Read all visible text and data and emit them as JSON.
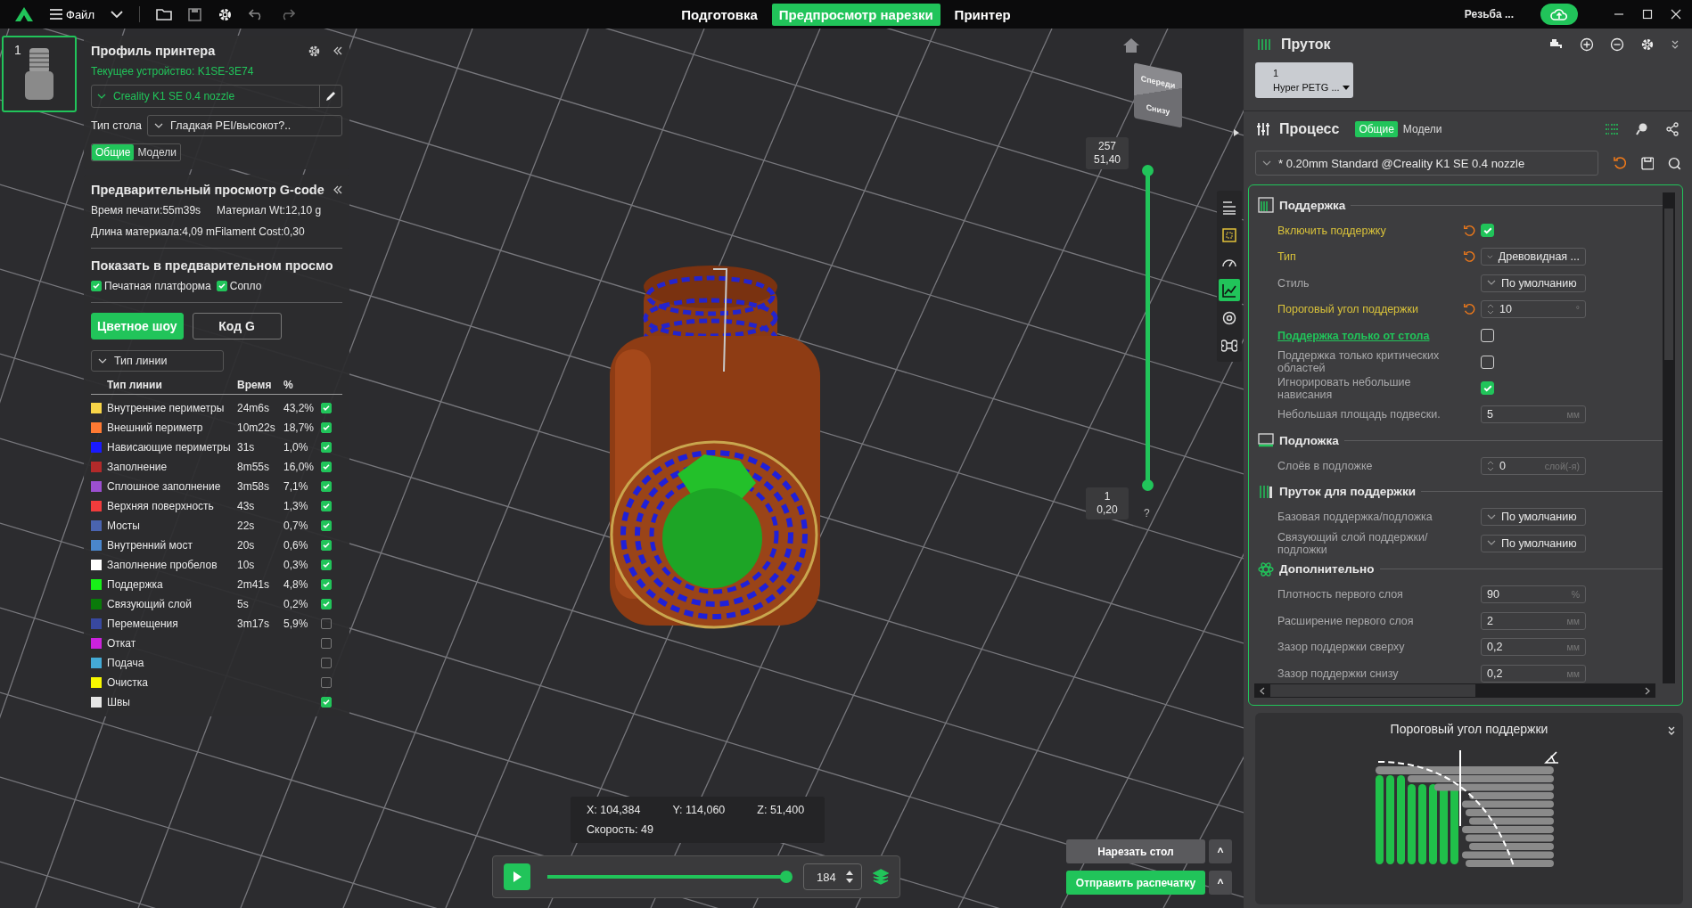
{
  "menu_bar": {
    "file_label": "Файл",
    "tabs": [
      {
        "label": "Подготовка",
        "selected": false
      },
      {
        "label": "Предпросмотр нарезки",
        "selected": true
      },
      {
        "label": "Принтер",
        "selected": false
      }
    ],
    "project_name": "Резьба ..."
  },
  "plates": [
    {
      "number": "1",
      "selected": true
    }
  ],
  "printer_profile": {
    "title": "Профиль принтера",
    "current_device": "Текущее устройство: K1SE-3E74",
    "printer": "Creality K1 SE 0.4 nozzle",
    "bed_label": "Тип стола",
    "bed_type": "Гладкая PEI/высокот?..",
    "tabs": [
      {
        "label": "Общие",
        "selected": true
      },
      {
        "label": "Модели",
        "selected": false
      }
    ]
  },
  "gcode_preview": {
    "title": "Предварительный просмотр G-code",
    "stats": [
      "Время печати:55m39s",
      "Материал Wt:12,10 g",
      "Длина материала:4,09 mFilament Cost:0,30"
    ],
    "show_title": "Показать в предварительном просмо",
    "show_options": [
      {
        "label": "Печатная платформа",
        "checked": true
      },
      {
        "label": "Сопло",
        "checked": true
      }
    ],
    "view_tabs": [
      {
        "label": "Цветное шоу",
        "selected": true
      },
      {
        "label": "Код G",
        "selected": false
      }
    ],
    "view_type": "Тип линии",
    "columns": [
      "Тип линии",
      "Время",
      "%"
    ],
    "rows": [
      {
        "color": "#f8d548",
        "name": "Внутренние периметры",
        "time": "24m6s",
        "percent": "43,2%",
        "checked": true
      },
      {
        "color": "#ff7a33",
        "name": "Внешний периметр",
        "time": "10m22s",
        "percent": "18,7%",
        "checked": true
      },
      {
        "color": "#1a1aff",
        "name": "Нависающие периметры",
        "time": "31s",
        "percent": "1,0%",
        "checked": true
      },
      {
        "color": "#b22a2a",
        "name": "Заполнение",
        "time": "8m55s",
        "percent": "16,0%",
        "checked": true
      },
      {
        "color": "#9b4fd0",
        "name": "Сплошное заполнение",
        "time": "3m58s",
        "percent": "7,1%",
        "checked": true
      },
      {
        "color": "#f03c3c",
        "name": "Верхняя поверхность",
        "time": "43s",
        "percent": "1,3%",
        "checked": true
      },
      {
        "color": "#4a64b0",
        "name": "Мосты",
        "time": "22s",
        "percent": "0,7%",
        "checked": true
      },
      {
        "color": "#4a86cc",
        "name": "Внутренний мост",
        "time": "20s",
        "percent": "0,6%",
        "checked": true
      },
      {
        "color": "#ffffff",
        "name": "Заполнение пробелов",
        "time": "10s",
        "percent": "0,3%",
        "checked": true
      },
      {
        "color": "#18f018",
        "name": "Поддержка",
        "time": "2m41s",
        "percent": "4,8%",
        "checked": true
      },
      {
        "color": "#0a7a0a",
        "name": "Связующий слой",
        "time": "5s",
        "percent": "0,2%",
        "checked": true
      },
      {
        "color": "#3848a0",
        "name": "Перемещения",
        "time": "3m17s",
        "percent": "5,9%",
        "checked": false
      },
      {
        "color": "#cc22dd",
        "name": "Откат",
        "checked": false
      },
      {
        "color": "#44aad6",
        "name": "Подача",
        "checked": false
      },
      {
        "color": "#f8f800",
        "name": "Очистка",
        "checked": false
      },
      {
        "color": "#e6e6e6",
        "name": "Швы",
        "checked": true
      }
    ]
  },
  "viewport": {
    "nav_cube": [
      "Спереди",
      "Снизу"
    ],
    "top_layer": [
      "257",
      "51,40"
    ],
    "bottom_layer": [
      "1",
      "0,20"
    ],
    "layer_slider": {
      "level": 1
    },
    "help": "?"
  },
  "position_info": {
    "x": "X: 104,384",
    "y": "Y: 114,060",
    "z": "Z: 51,400",
    "speed": "Скорость: 49"
  },
  "playback": {
    "level": 1,
    "layer": "184"
  },
  "actions": [
    {
      "label": "Нарезать стол",
      "kind": "secondary",
      "more": "^"
    },
    {
      "label": "Отправить распечатку",
      "kind": "primary",
      "more": "^"
    }
  ],
  "filament": {
    "title": "Пруток",
    "slots": [
      {
        "number": "1",
        "name": "Hyper PETG ..."
      }
    ]
  },
  "process": {
    "title": "Процесс",
    "tabs": [
      {
        "label": "Общие",
        "selected": true
      },
      {
        "label": "Модели",
        "selected": false
      }
    ],
    "preset": "* 0.20mm  Standard @Creality K1 SE 0.4 nozzle",
    "groups": [
      {
        "kind": "support",
        "title": "Поддержка",
        "settings": [
          {
            "kind": "checkbox",
            "label": "Включить поддержку",
            "checked": true,
            "modified": true,
            "link": false
          },
          {
            "kind": "select",
            "label": "Тип",
            "value": "Древовидная ...",
            "modified": true,
            "link": false
          },
          {
            "kind": "select",
            "label": "Стиль",
            "value": "По умолчанию",
            "modified": false,
            "link": false
          },
          {
            "kind": "spin",
            "label": "Пороговый угол поддержки",
            "value": "10",
            "unit": "°",
            "modified": true,
            "link": false
          },
          {
            "kind": "checkbox",
            "label": "Поддержка только от стола",
            "checked": false,
            "modified": false,
            "link": true
          },
          {
            "kind": "checkbox",
            "label": "Поддержка только критических областей",
            "checked": false,
            "modified": false,
            "link": false
          },
          {
            "kind": "checkbox",
            "label": "Игнорировать небольшие нависания",
            "checked": true,
            "modified": false,
            "link": false
          },
          {
            "kind": "input",
            "label": "Небольшая площадь подвески.",
            "value": "5",
            "unit": "мм",
            "modified": false,
            "link": false
          }
        ]
      },
      {
        "kind": "raft",
        "title": "Подложка",
        "settings": [
          {
            "kind": "spin",
            "label": "Слоёв в подложке",
            "value": "0",
            "unit": "слой(-я)",
            "modified": false,
            "link": false
          }
        ]
      },
      {
        "kind": "filament",
        "title": "Пруток для поддержки",
        "settings": [
          {
            "kind": "select",
            "label": "Базовая поддержка/подложка",
            "value": "По умолчанию",
            "modified": false,
            "link": false
          },
          {
            "kind": "select",
            "label": "Связующий слой поддержки/подложки",
            "value": "По умолчанию",
            "modified": false,
            "link": false
          }
        ]
      },
      {
        "kind": "advanced",
        "title": "Дополнительно",
        "settings": [
          {
            "kind": "input",
            "label": "Плотность первого слоя",
            "value": "90",
            "unit": "%",
            "modified": false,
            "link": false
          },
          {
            "kind": "input",
            "label": "Расширение первого слоя",
            "value": "2",
            "unit": "мм",
            "modified": false,
            "link": false
          },
          {
            "kind": "input",
            "label": "Зазор поддержки сверху",
            "value": "0,2",
            "unit": "мм",
            "modified": false,
            "link": false
          },
          {
            "kind": "input",
            "label": "Зазор поддержки снизу",
            "value": "0,2",
            "unit": "мм",
            "modified": false,
            "link": false
          }
        ]
      }
    ]
  },
  "hint_card": {
    "title": "Пороговый угол поддержки"
  }
}
